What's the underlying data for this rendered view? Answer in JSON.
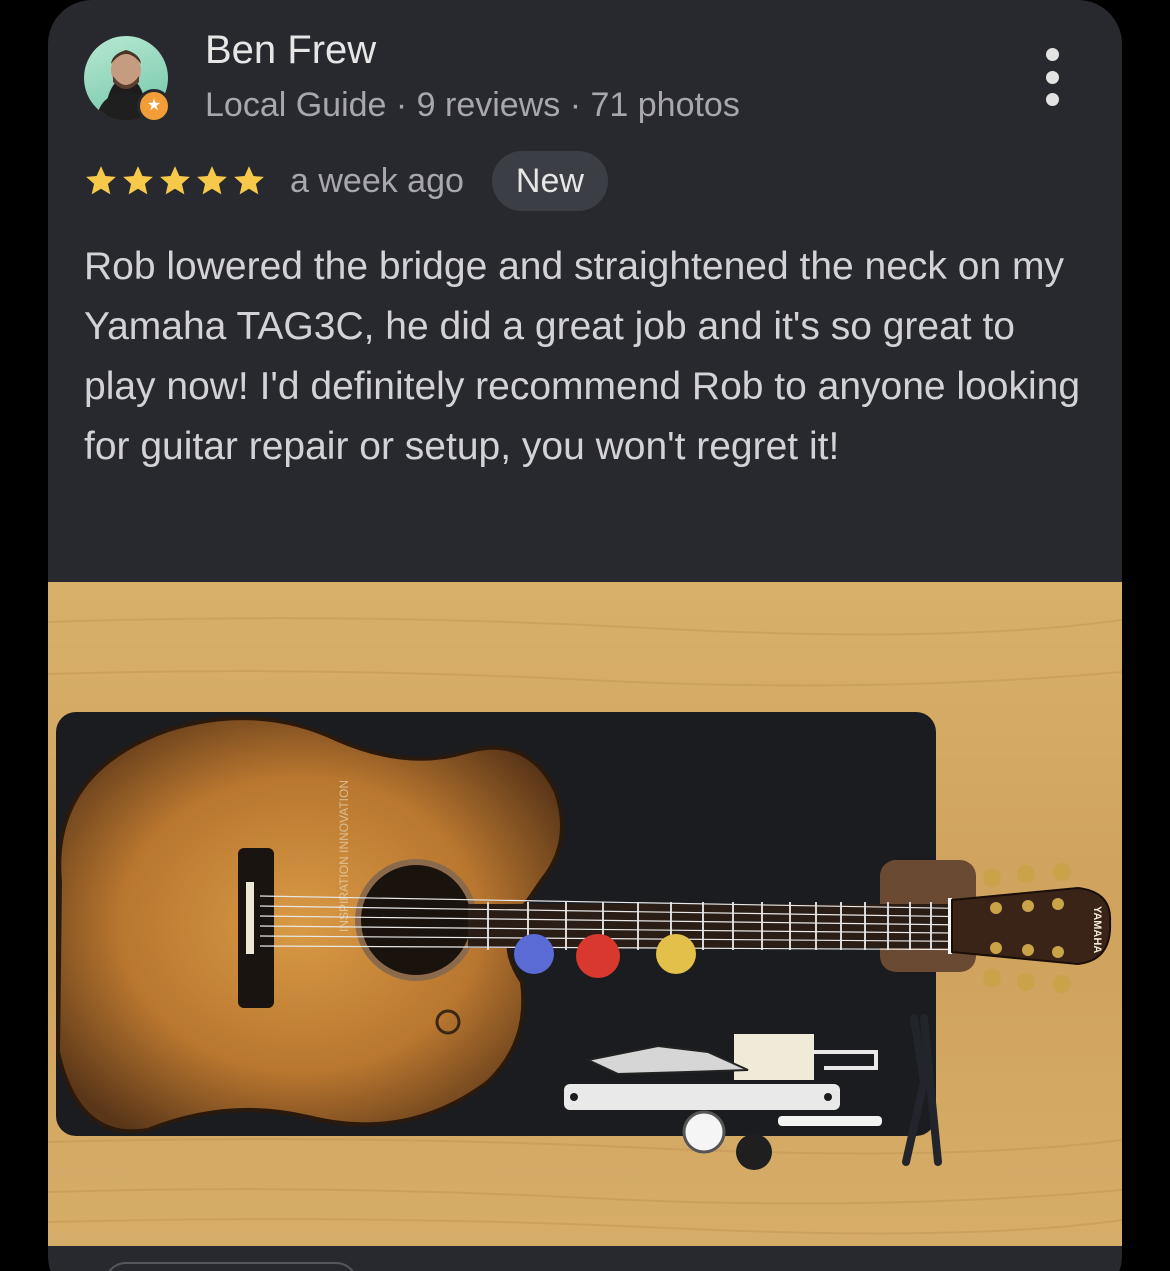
{
  "review": {
    "reviewer_name": "Ben Frew",
    "reviewer_meta": "Local Guide · 9 reviews · 71 photos",
    "rating": 5,
    "time_ago": "a week ago",
    "badge": "New",
    "text": "Rob lowered the bridge and straightened the neck on my Yamaha TAG3C, he did a great job and it's so great to play now! I'd definitely recommend Rob to anyone looking for guitar repair or setup, you won't regret it!",
    "photo_brand_text": "YAMAHA",
    "photo_label_text": "INSPIRATION INNOVATION"
  },
  "icons": {
    "avatar": "reviewer-avatar",
    "guide_badge": "local-guide-star-icon",
    "more": "more-vert-icon",
    "star": "star-icon"
  },
  "colors": {
    "card_bg": "#28292e",
    "page_bg": "#000000",
    "star": "#f7c94a",
    "badge_bg": "#3c3e45",
    "guide_badge": "#f29d38",
    "primary_text": "#e6e6e6",
    "secondary_text": "#a7a7ad"
  }
}
